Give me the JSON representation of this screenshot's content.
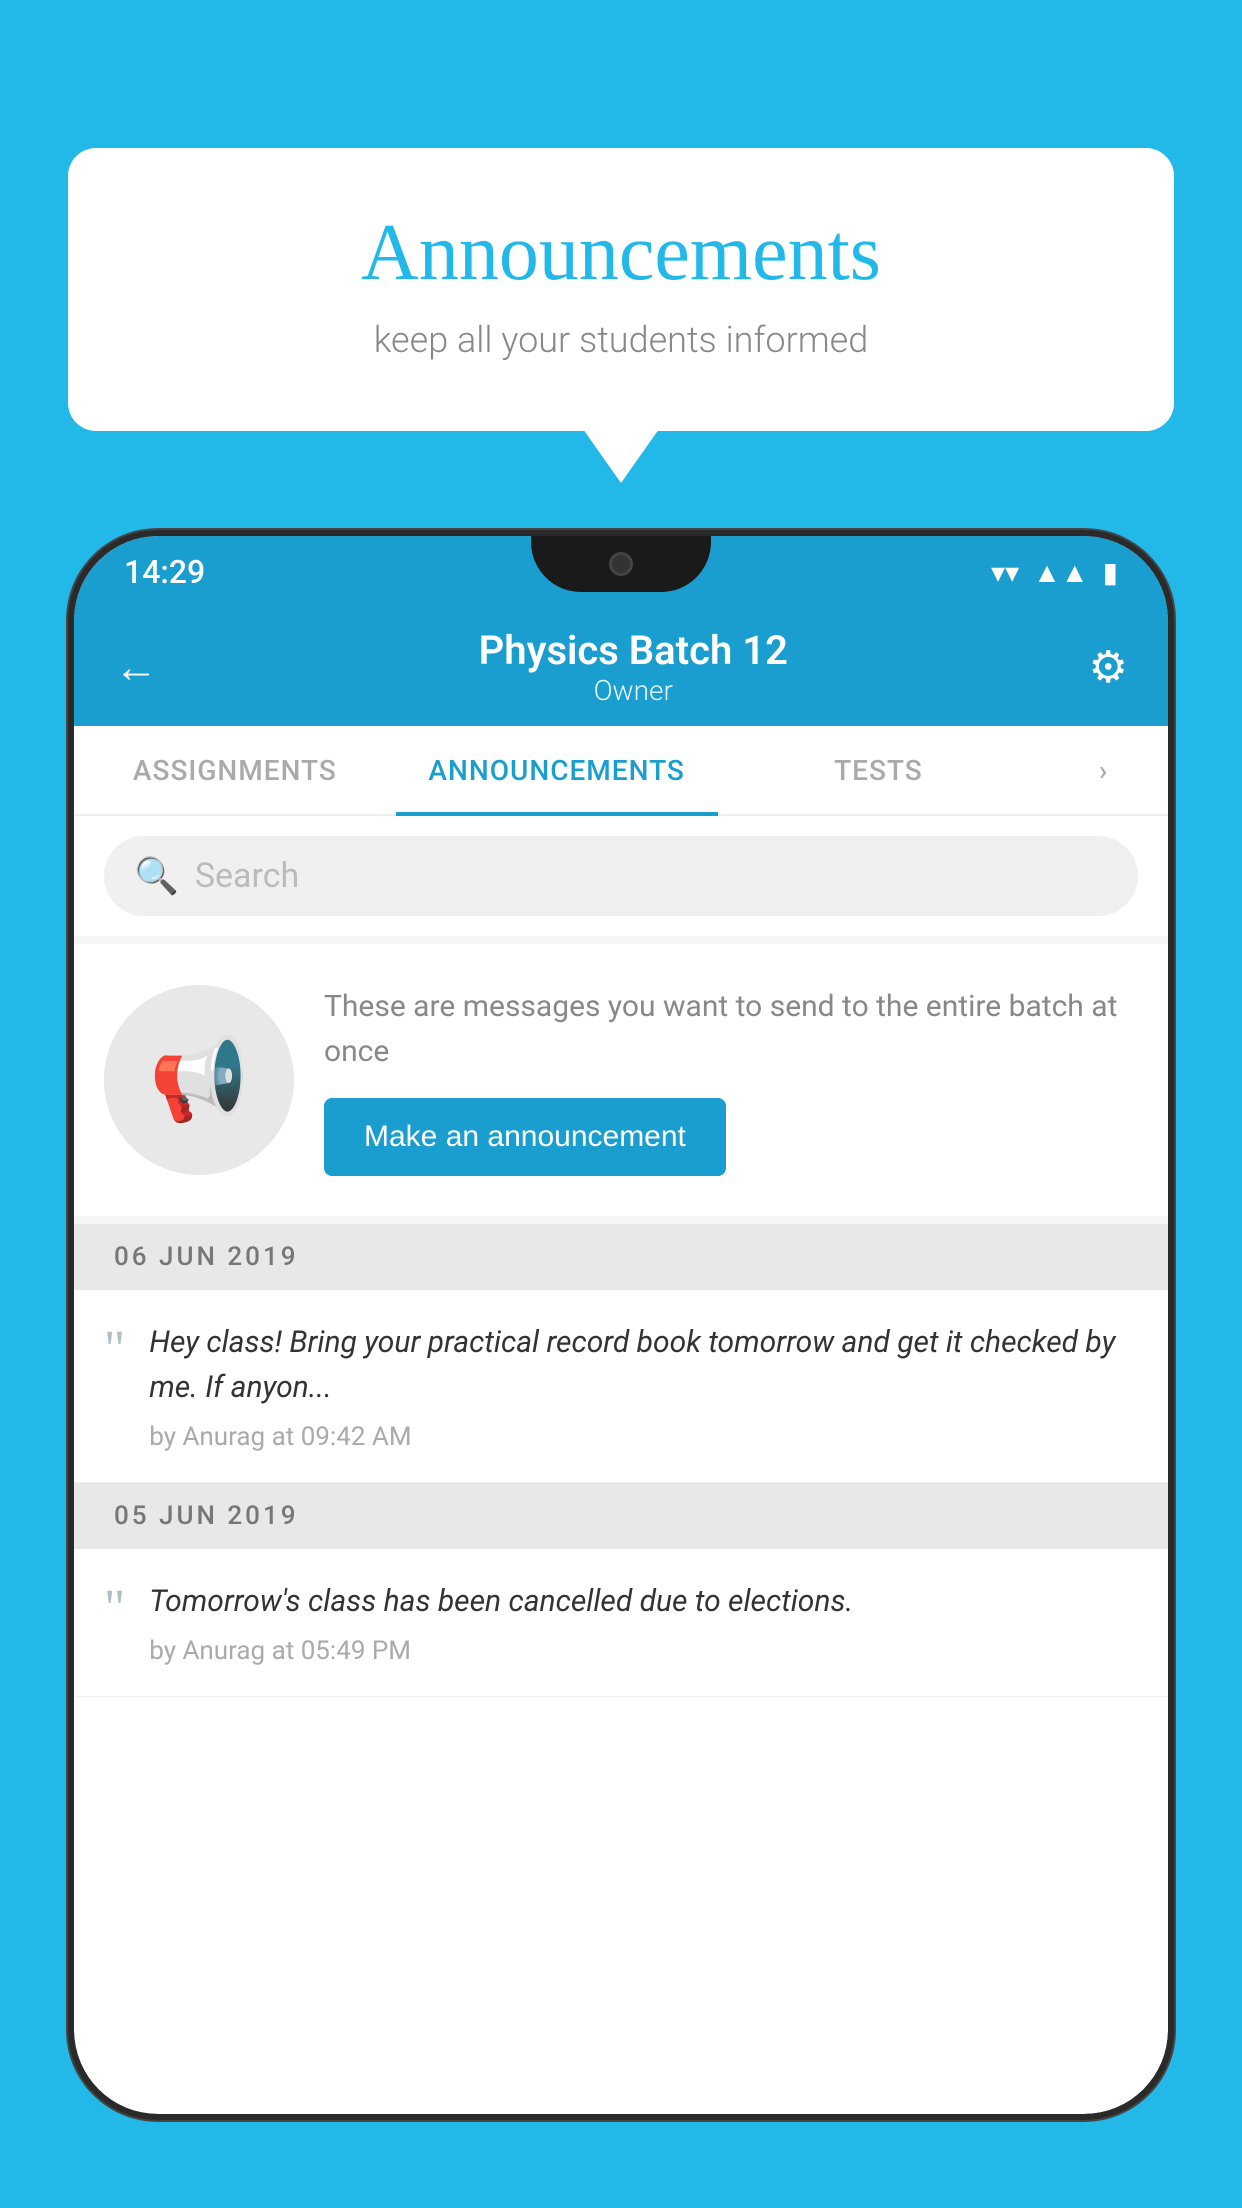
{
  "background_color": "#22b8e8",
  "speech_bubble": {
    "title": "Announcements",
    "subtitle": "keep all your students informed"
  },
  "status_bar": {
    "time": "14:29",
    "icons": [
      "wifi",
      "signal",
      "battery"
    ]
  },
  "app_bar": {
    "title": "Physics Batch 12",
    "subtitle": "Owner",
    "back_label": "←",
    "settings_label": "⚙"
  },
  "tabs": [
    {
      "label": "ASSIGNMENTS",
      "active": false
    },
    {
      "label": "ANNOUNCEMENTS",
      "active": true
    },
    {
      "label": "TESTS",
      "active": false
    },
    {
      "label": "›",
      "active": false
    }
  ],
  "search": {
    "placeholder": "Search"
  },
  "announcement_prompt": {
    "description_text": "These are messages you want to send to the entire batch at once",
    "button_label": "Make an announcement"
  },
  "date_sections": [
    {
      "date": "06  JUN  2019",
      "announcements": [
        {
          "text": "Hey class! Bring your practical record book tomorrow and get it checked by me. If anyon...",
          "meta": "by Anurag at 09:42 AM"
        }
      ]
    },
    {
      "date": "05  JUN  2019",
      "announcements": [
        {
          "text": "Tomorrow's class has been cancelled due to elections.",
          "meta": "by Anurag at 05:49 PM"
        }
      ]
    }
  ]
}
